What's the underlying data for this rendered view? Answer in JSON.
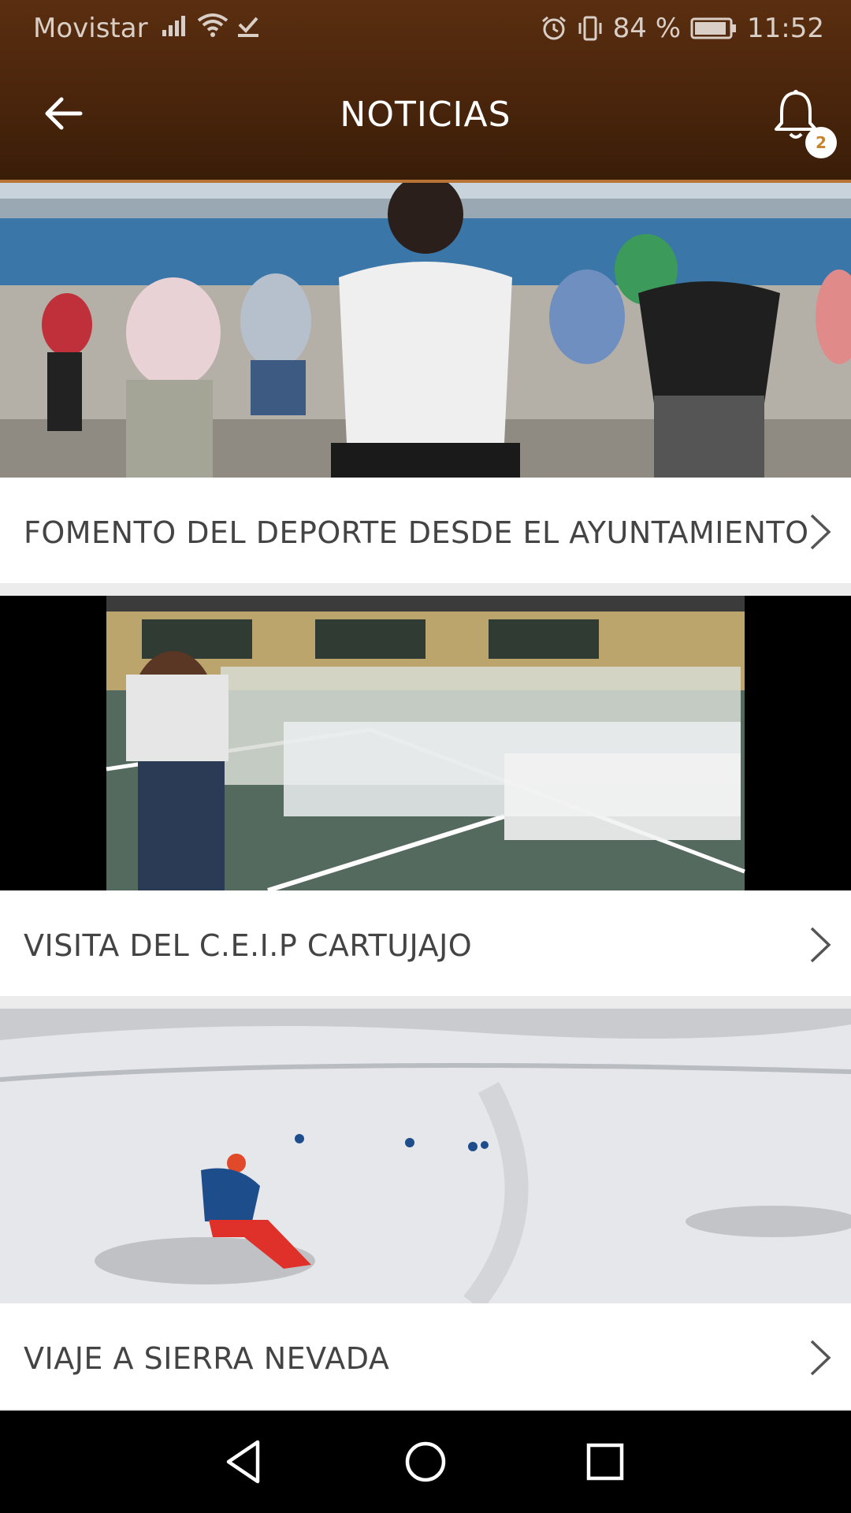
{
  "status_bar": {
    "carrier": "Movistar",
    "battery": "84 %",
    "time": "11:52"
  },
  "app_bar": {
    "title": "NOTICIAS",
    "back_icon": "arrow-left-icon",
    "notification_icon": "bell-icon",
    "notification_count": "2"
  },
  "news": [
    {
      "title": "FOMENTO DEL DEPORTE DESDE EL AYUNTAMIENTO",
      "image": "outdoor-fitness-class-photo"
    },
    {
      "title": "VISITA DEL C.E.I.P CARTUJAJO",
      "image": "school-children-gym-photo"
    },
    {
      "title": "VIAJE A SIERRA NEVADA",
      "image": "ski-slope-photo"
    }
  ],
  "nav_bar": {
    "back": "triangle-back-icon",
    "home": "circle-home-icon",
    "recents": "square-recents-icon"
  },
  "colors": {
    "header_brown": "#4a250c",
    "accent_orange": "#c8842d",
    "title_text": "#444444"
  }
}
